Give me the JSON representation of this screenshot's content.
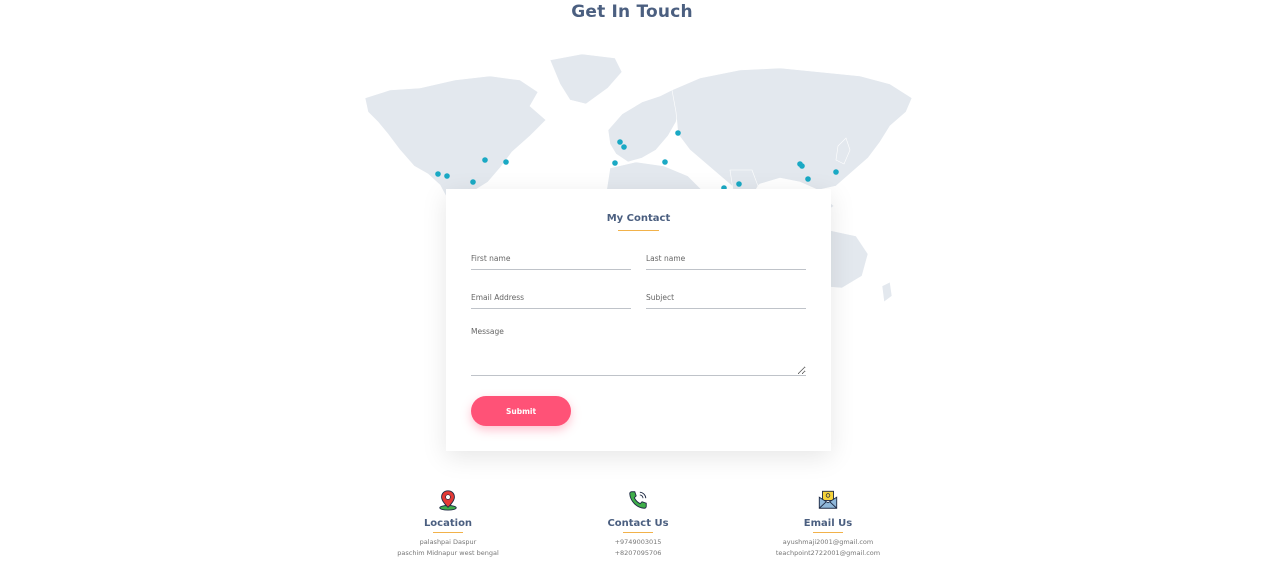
{
  "page": {
    "title": "Get In Touch"
  },
  "contact_form": {
    "title": "My Contact",
    "first_name_placeholder": "First name",
    "last_name_placeholder": "Last name",
    "email_placeholder": "Email Address",
    "subject_placeholder": "Subject",
    "message_placeholder": "Message",
    "submit_label": "Submit"
  },
  "info_blocks": [
    {
      "icon": "location-pin-icon",
      "title": "Location",
      "lines": [
        "palashpai Daspur",
        "paschim Midnapur west bengal"
      ]
    },
    {
      "icon": "phone-icon",
      "title": "Contact Us",
      "lines": [
        "+9749003015",
        "+8207095706"
      ]
    },
    {
      "icon": "mail-icon",
      "title": "Email Us",
      "lines": [
        "ayushmaji2001@gmail.com",
        "teachpoint2722001@gmail.com"
      ]
    }
  ],
  "colors": {
    "heading": "#4b5f80",
    "accent_line": "#f2b24a",
    "button": "#ff5277",
    "map_land": "#e3e8ee",
    "map_dot": "#1aa9c4"
  }
}
